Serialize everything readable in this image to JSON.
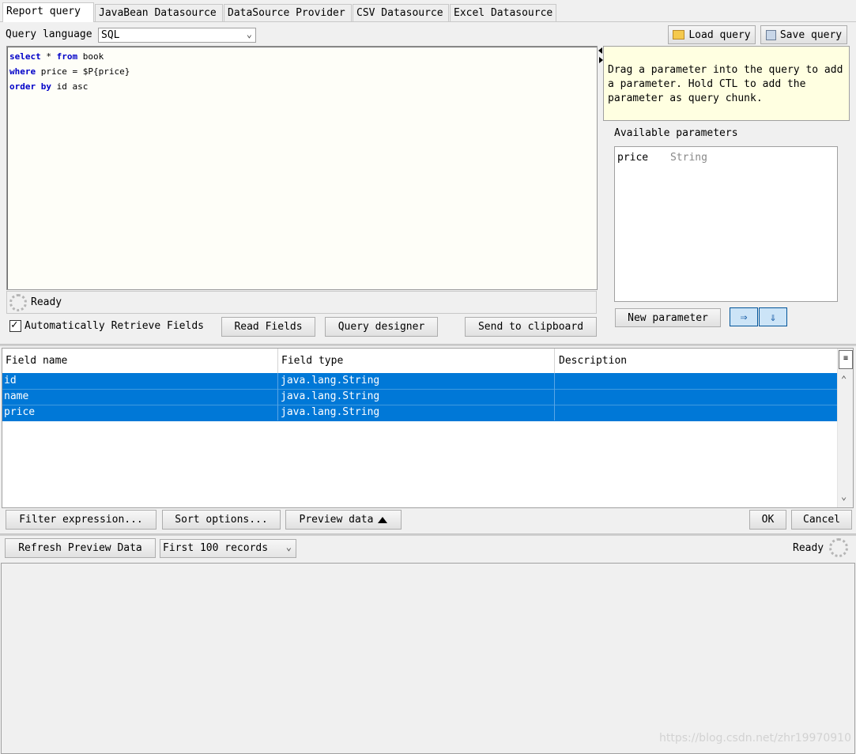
{
  "tabs": [
    "Report query",
    "JavaBean Datasource",
    "DataSource Provider",
    "CSV Datasource",
    "Excel Datasource"
  ],
  "query_language": {
    "label": "Query language",
    "value": "SQL"
  },
  "toolbar": {
    "load_label": "Load query",
    "save_label": "Save query"
  },
  "query_lines": [
    {
      "kw": "select",
      "sym": " * ",
      "kw2": "from",
      "rest": " book"
    },
    {
      "kw": "where",
      "sym": " price = $P{price}",
      "kw2": "",
      "rest": ""
    },
    {
      "kw": "order by",
      "sym": " id asc",
      "kw2": "",
      "rest": ""
    }
  ],
  "hint": "Drag a parameter into the query to add a parameter. Hold CTL to add the parameter as query chunk.",
  "params": {
    "label": "Available parameters",
    "items": [
      {
        "name": "price",
        "type": "String"
      }
    ],
    "new_label": "New parameter"
  },
  "status": {
    "text": "Ready"
  },
  "actions": {
    "auto_retrieve": "Automatically Retrieve Fields",
    "auto_checked": true,
    "read_fields": "Read Fields",
    "query_designer": "Query designer",
    "clipboard": "Send to clipboard"
  },
  "fields_table": {
    "headers": [
      "Field name",
      "Field type",
      "Description"
    ],
    "rows": [
      {
        "name": "id",
        "type": "java.lang.String",
        "desc": ""
      },
      {
        "name": "name",
        "type": "java.lang.String",
        "desc": ""
      },
      {
        "name": "price",
        "type": "java.lang.String",
        "desc": ""
      }
    ]
  },
  "bottom_bar": {
    "filter": "Filter expression...",
    "sort": "Sort options...",
    "preview": "Preview data",
    "ok": "OK",
    "cancel": "Cancel"
  },
  "preview": {
    "refresh": "Refresh Preview Data",
    "records": "First 100 records",
    "status": "Ready"
  },
  "watermark": "https://blog.csdn.net/zhr19970910",
  "colors": {
    "selection": "#0078d7",
    "hint_bg": "#ffffe1",
    "keyword": "#0000c8"
  }
}
